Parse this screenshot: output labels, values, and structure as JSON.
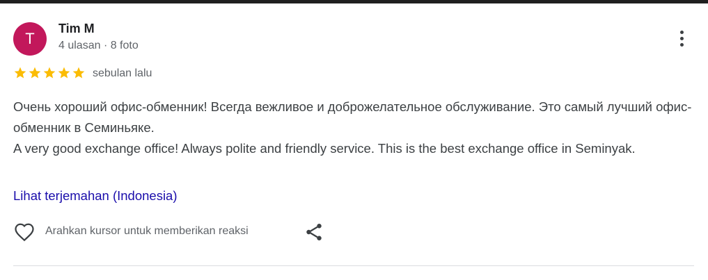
{
  "review": {
    "avatar_letter": "T",
    "avatar_color": "#c2185b",
    "author_name": "Tim M",
    "author_meta": "4 ulasan · 8 foto",
    "rating": 5,
    "rating_max": 5,
    "star_color": "#fbbc04",
    "time_ago": "sebulan lalu",
    "text_lines": [
      "Очень хороший офис-обменник! Всегда вежливое и доброжелательное обслуживание. Это самый лучший офис-обменник в Семиньяке.",
      "A very good exchange office! Always polite and friendly service. This is the best exchange office in Seminyak."
    ],
    "translate_link": "Lihat terjemahan (Indonesia)",
    "link_color": "#1a0dab",
    "reaction_hint": "Arahkan kursor untuk memberikan reaksi",
    "icons": {
      "more": "more-vert-icon",
      "react": "heart-outline-icon",
      "share": "share-icon"
    }
  }
}
